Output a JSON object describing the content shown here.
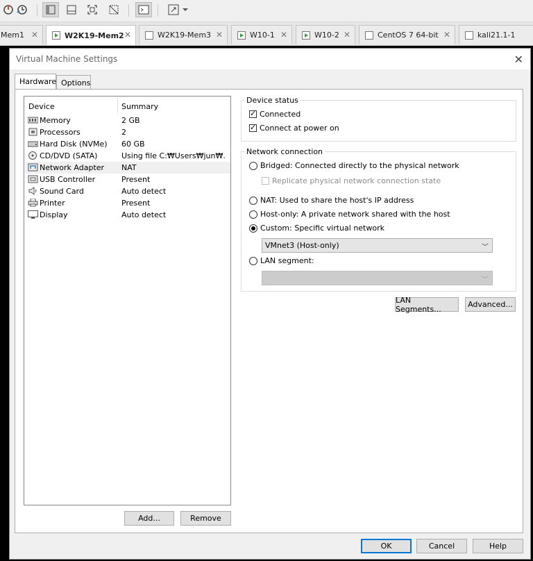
{
  "tabs": [
    {
      "label": "Mem1",
      "active": false
    },
    {
      "label": "W2K19-Mem2",
      "active": true
    },
    {
      "label": "W2K19-Mem3",
      "active": false
    },
    {
      "label": "W10-1",
      "active": false
    },
    {
      "label": "W10-2",
      "active": false
    },
    {
      "label": "CentOS 7 64-bit",
      "active": false
    },
    {
      "label": "kali21.1-1",
      "active": false
    }
  ],
  "dialog": {
    "title": "Virtual Machine Settings",
    "tabs": {
      "hardware": "Hardware",
      "options": "Options"
    },
    "device_list": {
      "headers": {
        "device": "Device",
        "summary": "Summary"
      },
      "rows": [
        {
          "device": "Memory",
          "summary": "2 GB",
          "icon": "memory-icon"
        },
        {
          "device": "Processors",
          "summary": "2",
          "icon": "processor-icon"
        },
        {
          "device": "Hard Disk (NVMe)",
          "summary": "60 GB",
          "icon": "hard-disk-icon"
        },
        {
          "device": "CD/DVD (SATA)",
          "summary": "Using file C:₩Users₩jun₩...",
          "icon": "cd-dvd-icon"
        },
        {
          "device": "Network Adapter",
          "summary": "NAT",
          "icon": "network-adapter-icon",
          "selected": true
        },
        {
          "device": "USB Controller",
          "summary": "Present",
          "icon": "usb-icon"
        },
        {
          "device": "Sound Card",
          "summary": "Auto detect",
          "icon": "sound-card-icon"
        },
        {
          "device": "Printer",
          "summary": "Present",
          "icon": "printer-icon"
        },
        {
          "device": "Display",
          "summary": "Auto detect",
          "icon": "display-icon"
        }
      ],
      "add_label": "Add...",
      "remove_label": "Remove"
    },
    "device_status": {
      "label": "Device status",
      "connected": "Connected",
      "connect_at_power_on": "Connect at power on"
    },
    "network_connection": {
      "label": "Network connection",
      "bridged": "Bridged: Connected directly to the physical network",
      "replicate": "Replicate physical network connection state",
      "nat": "NAT: Used to share the host's IP address",
      "host_only": "Host-only: A private network shared with the host",
      "custom": "Custom: Specific virtual network",
      "custom_value": "VMnet3 (Host-only)",
      "lan_segment": "LAN segment:",
      "lan_segment_value": ""
    },
    "lan_segments_label": "LAN Segments...",
    "advanced_label": "Advanced...",
    "ok_label": "OK",
    "cancel_label": "Cancel",
    "help_label": "Help"
  },
  "colors": {
    "accent": "#0078d7",
    "tab_active": "#ffffff",
    "play_green": "#3b9d3b"
  }
}
